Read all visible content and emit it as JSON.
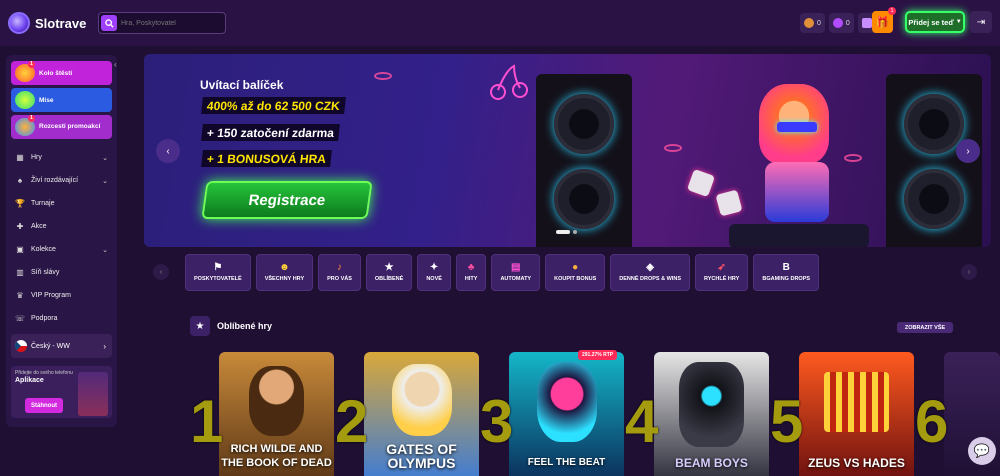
{
  "header": {
    "logo_text": "Slotrave",
    "search_placeholder": "Hra, Poskytovatel",
    "counters": [
      {
        "value": "0",
        "color": "#e0903a"
      },
      {
        "value": "0",
        "color": "#b14cff"
      },
      {
        "value": "0",
        "color": "#c78cff"
      }
    ],
    "gift_badge": "1",
    "join_label": "Přidej se teď",
    "login_icon": "login-icon"
  },
  "sidebar": {
    "promos": [
      {
        "label": "Kolo štěstí",
        "badge": "1",
        "color": "#c023d9"
      },
      {
        "label": "Mise",
        "badge": "",
        "color": "#2a5be0"
      },
      {
        "label": "Rozcestí promoakcí",
        "badge": "1",
        "color": "#a22dcc"
      }
    ],
    "nav": [
      {
        "label": "Hry",
        "icon": "slots-icon",
        "has_chevron": true
      },
      {
        "label": "Živí rozdávající",
        "icon": "cards-icon",
        "has_chevron": true
      },
      {
        "label": "Turnaje",
        "icon": "trophy-icon",
        "has_chevron": false
      },
      {
        "label": "Akce",
        "icon": "gift-icon",
        "has_chevron": false
      },
      {
        "label": "Kolekce",
        "icon": "collection-icon",
        "has_chevron": true
      },
      {
        "label": "Síň slávy",
        "icon": "chart-icon",
        "has_chevron": false
      },
      {
        "label": "VIP Program",
        "icon": "crown-icon",
        "has_chevron": false
      },
      {
        "label": "Podpora",
        "icon": "support-icon",
        "has_chevron": false
      }
    ],
    "language": "Český - WW",
    "app": {
      "small": "Přidejte do svého telefonu",
      "title": "Aplikace",
      "button": "Stáhnout"
    }
  },
  "hero": {
    "title": "Uvítací balíček",
    "line1": "400% až do 62 500 CZK",
    "line2": "+ 150 zatočení zdarma",
    "line3": "+ 1 BONUSOVÁ HRA",
    "cta": "Registrace",
    "slide_count": 2,
    "active_slide": 1
  },
  "categories": [
    {
      "label": "POSKYTOVATELÉ",
      "icon": "flag-icon"
    },
    {
      "label": "VŠECHNY HRY",
      "icon": "smiley-icon"
    },
    {
      "label": "PRO VÁS",
      "icon": "music-icon"
    },
    {
      "label": "OBLÍBENÉ",
      "icon": "star-icon"
    },
    {
      "label": "NOVÉ",
      "icon": "sparkle-icon"
    },
    {
      "label": "HITY",
      "icon": "joystick-icon"
    },
    {
      "label": "AUTOMATY",
      "icon": "slot-machine-icon"
    },
    {
      "label": "KOUPIT BONUS",
      "icon": "coin-icon"
    },
    {
      "label": "DENNÉ DROPS & WINS",
      "icon": "drops-icon"
    },
    {
      "label": "RYCHLÉ HRY",
      "icon": "rocket-icon"
    },
    {
      "label": "BGAMING DROPS",
      "icon": "b-icon"
    }
  ],
  "favorites": {
    "title": "Oblíbené hry",
    "view_all": "ZOBRAZIT VŠE",
    "rtp_badge": "291.27% RTP",
    "games": [
      {
        "rank": "1",
        "name": "RICH WILDE AND THE BOOK OF DEAD"
      },
      {
        "rank": "2",
        "name": "GATES OF OLYMPUS"
      },
      {
        "rank": "3",
        "name": "FEEL THE BEAT"
      },
      {
        "rank": "4",
        "name": "BEAM BOYS"
      },
      {
        "rank": "5",
        "name": "ZEUS VS HADES"
      },
      {
        "rank": "6",
        "name": ""
      }
    ]
  }
}
